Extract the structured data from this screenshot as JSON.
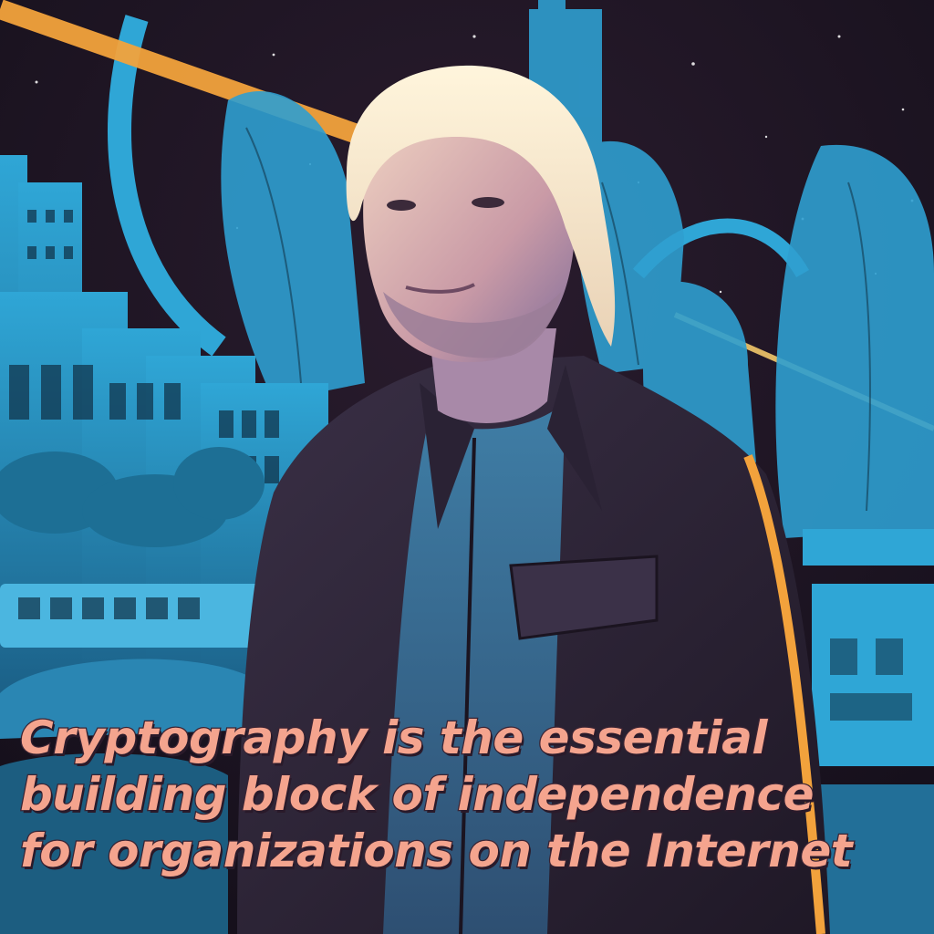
{
  "caption": {
    "lines": [
      "Cryptography is the essential",
      "building block of independence",
      "for organizations on the Internet"
    ]
  },
  "colors": {
    "sky": "#1e1624",
    "cyan": "#2fa6d6",
    "cyan_light": "#5cc3e6",
    "orange": "#f2a23c",
    "caption_text": "#f4a48e",
    "jacket": "#2d2436"
  }
}
